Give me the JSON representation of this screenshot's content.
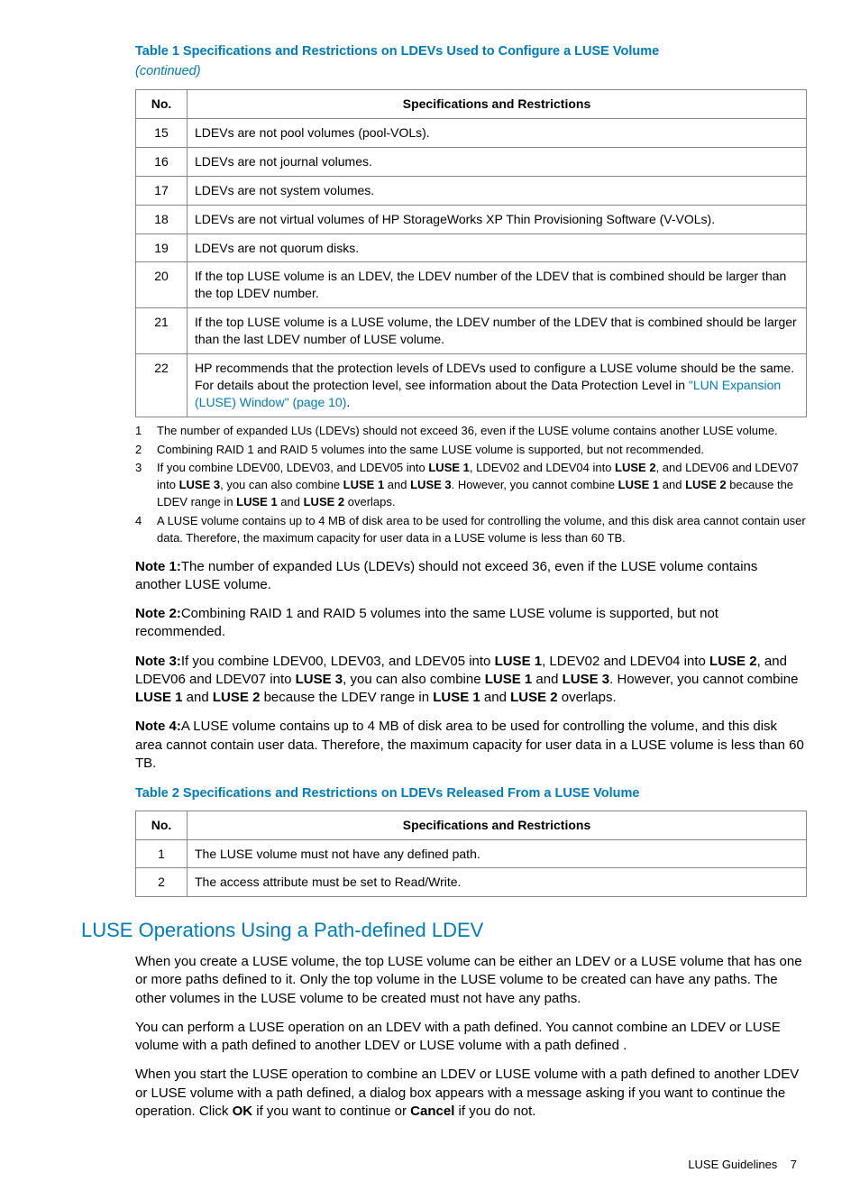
{
  "table1": {
    "title": "Table 1 Specifications and Restrictions on LDEVs Used to Configure a LUSE Volume",
    "subtitle": "(continued)",
    "head_no": "No.",
    "head_spec": "Specifications and Restrictions",
    "rows": [
      {
        "no": "15",
        "text": "LDEVs are not pool volumes (pool-VOLs)."
      },
      {
        "no": "16",
        "text": "LDEVs are not journal volumes."
      },
      {
        "no": "17",
        "text": "LDEVs are not system volumes."
      },
      {
        "no": "18",
        "text": "LDEVs are not virtual volumes of HP StorageWorks XP Thin Provisioning Software (V-VOLs)."
      },
      {
        "no": "19",
        "text": "LDEVs are not quorum disks."
      },
      {
        "no": "20",
        "text": "If the top LUSE volume is an LDEV, the LDEV number of the LDEV that is combined should be larger than the top LDEV number."
      },
      {
        "no": "21",
        "text": "If the top LUSE volume is a LUSE volume, the LDEV number of the LDEV that is combined should be larger than the last LDEV number of LUSE volume."
      }
    ],
    "row22": {
      "no": "22",
      "pre": "HP recommends that the protection levels of LDEVs used to configure a LUSE volume should be the same. For details about the protection level, see information about the Data Protection Level in ",
      "link": "\"LUN Expansion (LUSE) Window\" (page 10)",
      "post": "."
    }
  },
  "footnotes": {
    "f1": {
      "n": "1",
      "t": "The number of expanded LUs (LDEVs) should not exceed 36, even if the LUSE volume contains another LUSE volume."
    },
    "f2": {
      "n": "2",
      "t": "Combining RAID 1 and RAID 5 volumes into the same LUSE volume is supported, but not recommended."
    },
    "f3": {
      "n": "3",
      "p1": "If you combine LDEV00, LDEV03, and LDEV05 into ",
      "b1": "LUSE 1",
      "p2": ", LDEV02 and LDEV04 into ",
      "b2": "LUSE 2",
      "p3": ", and LDEV06 and LDEV07 into ",
      "b3": "LUSE 3",
      "p4": ", you can also combine ",
      "b4": "LUSE 1",
      "p5": " and ",
      "b5": "LUSE 3",
      "p6": ". However, you cannot combine ",
      "b6": "LUSE 1",
      "p7": " and ",
      "b7": "LUSE 2",
      "p8": " because the LDEV range in ",
      "b8": "LUSE 1",
      "p9": " and ",
      "b9": "LUSE 2",
      "p10": " overlaps."
    },
    "f4": {
      "n": "4",
      "t": "A LUSE volume contains up to 4 MB of disk area to be used for controlling the volume, and this disk area cannot contain user data. Therefore, the maximum capacity for user data in a LUSE volume is less than 60 TB."
    }
  },
  "notes": {
    "n1": {
      "label": "Note 1:",
      "text": "The number of expanded LUs (LDEVs) should not exceed 36, even if the LUSE volume contains another LUSE volume."
    },
    "n2": {
      "label": "Note 2:",
      "text": "Combining RAID 1 and RAID 5 volumes into the same LUSE volume is supported, but not recommended."
    },
    "n3": {
      "label": "Note 3:",
      "p1": "If you combine LDEV00, LDEV03, and LDEV05 into ",
      "b1": "LUSE 1",
      "p2": ", LDEV02 and LDEV04 into ",
      "b2": "LUSE 2",
      "p3": ", and LDEV06 and LDEV07 into ",
      "b3": "LUSE 3",
      "p4": ", you can also combine ",
      "b4": "LUSE 1",
      "p5": " and ",
      "b5": "LUSE 3",
      "p6": ". However, you cannot combine ",
      "b6": "LUSE 1",
      "p7": " and ",
      "b7": "LUSE 2",
      "p8": " because the LDEV range in ",
      "b8": "LUSE 1",
      "p9": " and ",
      "b9": "LUSE 2",
      "p10": " overlaps."
    },
    "n4": {
      "label": "Note 4:",
      "text": "A LUSE volume contains up to 4 MB of disk area to be used for controlling the volume, and this disk area cannot contain user data. Therefore, the maximum capacity for user data in a LUSE volume is less than 60 TB."
    }
  },
  "table2": {
    "title": "Table 2 Specifications and Restrictions on LDEVs Released From a LUSE Volume",
    "head_no": "No.",
    "head_spec": "Specifications and Restrictions",
    "rows": [
      {
        "no": "1",
        "text": "The LUSE volume must not have any defined path."
      },
      {
        "no": "2",
        "text": "The access attribute must be set to Read/Write."
      }
    ]
  },
  "section": {
    "heading": "LUSE Operations Using a Path-defined LDEV",
    "p1": "When you create a LUSE volume, the top LUSE volume can be either an LDEV or a LUSE volume that has one or more paths defined to it. Only the top volume in the LUSE volume to be created can have any paths. The other volumes in the LUSE volume to be created must not have any paths.",
    "p2": "You can perform a LUSE operation on an LDEV with a path defined. You cannot combine an LDEV or LUSE volume with a path defined to another LDEV or LUSE volume with a path defined .",
    "p3a": "When you start the LUSE operation to combine an LDEV or LUSE volume with a path defined to another LDEV or LUSE volume with a path defined, a dialog box appears with a message asking if you want to continue the operation. Click ",
    "p3b1": "OK",
    "p3c": " if you want to continue or ",
    "p3b2": "Cancel",
    "p3d": " if you do not."
  },
  "footer": {
    "text": "LUSE Guidelines",
    "page": "7"
  }
}
